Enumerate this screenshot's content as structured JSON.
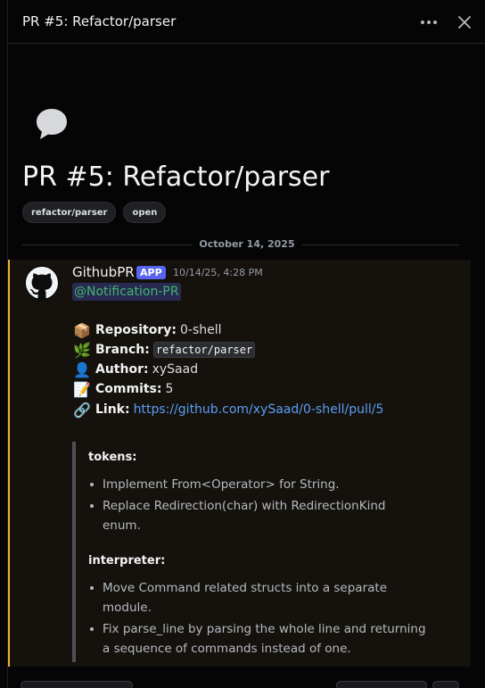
{
  "header": {
    "title": "PR #5: Refactor/parser"
  },
  "thread": {
    "title": "PR #5: Refactor/parser",
    "tags": [
      "refactor/parser",
      "open"
    ]
  },
  "divider": {
    "date": "October 14, 2025"
  },
  "message": {
    "author": "GithubPR",
    "badge": "APP",
    "timestamp": "10/14/25, 4:28 PM",
    "mention": "@Notification-PR",
    "fields": {
      "repository": {
        "label": "Repository:",
        "value": "0-shell",
        "emoji": "📦"
      },
      "branch": {
        "label": "Branch:",
        "value": "refactor/parser",
        "emoji": "🌿"
      },
      "author": {
        "label": "Author:",
        "value": "xySaad",
        "emoji": "👤"
      },
      "commits": {
        "label": "Commits:",
        "value": "5",
        "emoji": "📝"
      },
      "link": {
        "label": "Link:",
        "value": "https://github.com/xySaad/0-shell/pull/5",
        "emoji": "🔗"
      }
    },
    "embed": {
      "sections": [
        {
          "heading": "tokens:",
          "items": [
            "Implement From<Operator> for String.",
            "Replace Redirection(char) with RedirectionKind enum."
          ]
        },
        {
          "heading": "interpreter:",
          "items": [
            "Move Command related structs into a separate module.",
            "Fix parse_line by parsing the whole line and returning a sequence of commands instead of one."
          ]
        }
      ]
    }
  },
  "colors": {
    "accent_bar": "#f0b232",
    "app_badge": "#5865f2",
    "mention_text": "#40b66b",
    "link": "#5b9ef5"
  },
  "icons": {
    "header_more": "more-horizontal-icon",
    "header_close": "close-icon",
    "thread": "chat-bubble-icon",
    "avatar": "github-icon"
  }
}
